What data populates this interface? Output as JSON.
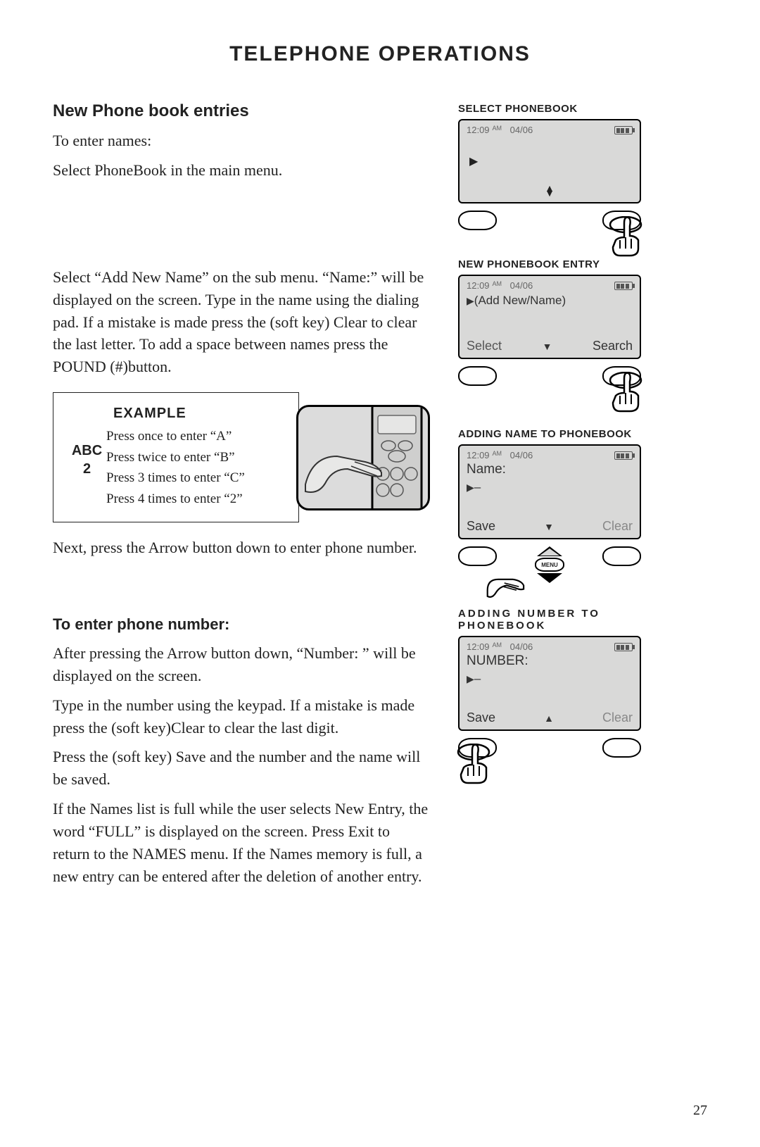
{
  "title": "TELEPHONE OPERATIONS",
  "heading1": "New Phone book entries",
  "p1": "To enter names:",
  "p2": "Select PhoneBook in the main menu.",
  "p3": "Select “Add New Name” on the sub menu. “Name:” will be displayed on the screen. Type in the name using the dialing pad. If a mistake is made press the (soft key) Clear to clear the last letter. To add a space between names press the POUND (#)button.",
  "example": {
    "title": "EXAMPLE",
    "key_label_top": "ABC",
    "key_label_bottom": "2",
    "line1": "Press once to enter “A”",
    "line2": "Press twice to enter “B”",
    "line3": "Press 3 times to enter “C”",
    "line4": "Press 4 times to enter “2”"
  },
  "p4": "Next, press the Arrow button down to enter phone number.",
  "heading2": "To enter phone number:",
  "p5": "After pressing the Arrow button down, “Number: ” will be displayed on the screen.",
  "p6": "Type in the number using the keypad. If a mistake is made press the (soft key)Clear to clear the last digit.",
  "p7": "Press the (soft key) Save and the number and the name will be saved.",
  "p8": "If the Names list is full while the user selects New Entry, the word “FULL” is displayed on the screen. Press Exit to return to the NAMES menu. If the Names memory is full, a new entry can be entered after the deletion of another entry.",
  "panels": {
    "p1": {
      "caption": "SELECT PHONEBOOK",
      "time": "12:09",
      "ampm": "AM",
      "date": "04/06"
    },
    "p2": {
      "caption": "NEW PHONEBOOK ENTRY",
      "time": "12:09",
      "ampm": "AM",
      "date": "04/06",
      "line": "(Add New/Name)",
      "left": "Select",
      "right": "Search"
    },
    "p3": {
      "caption": "ADDING NAME TO PHONEBOOK",
      "time": "12:09",
      "ampm": "AM",
      "date": "04/06",
      "label": "Name:",
      "cursor": "–",
      "left": "Save",
      "right": "Clear",
      "menu": "MENU"
    },
    "p4": {
      "caption": "ADDING NUMBER TO PHONEBOOK",
      "time": "12:09",
      "ampm": "AM",
      "date": "04/06",
      "label": "NUMBER:",
      "cursor": "–",
      "left": "Save",
      "right": "Clear"
    }
  },
  "page_number": "27"
}
